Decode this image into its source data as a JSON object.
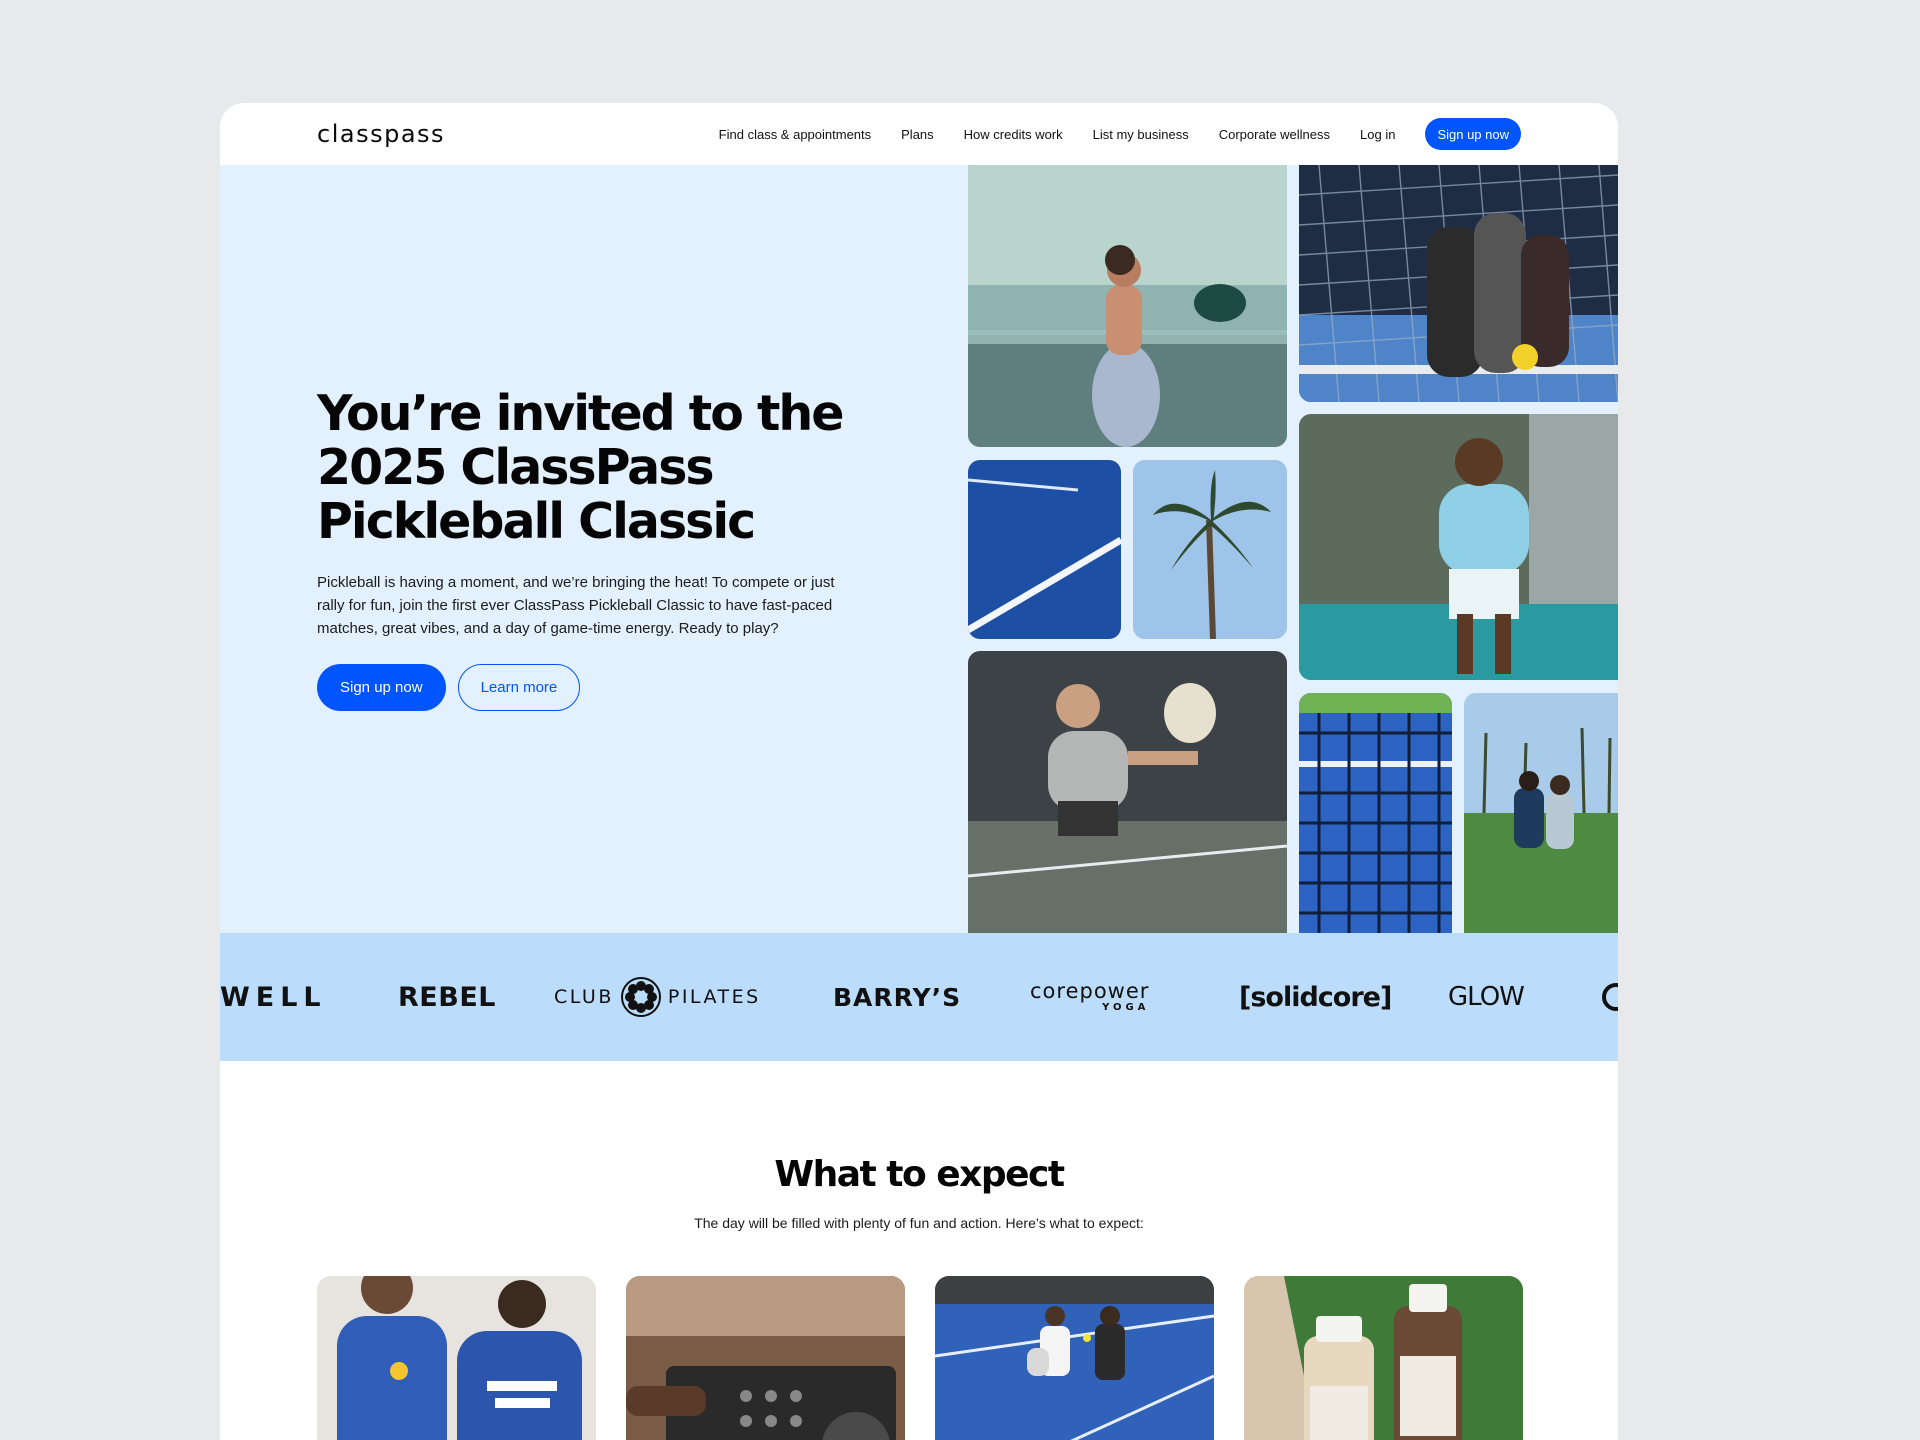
{
  "header": {
    "logo": "classpass",
    "nav": [
      {
        "label": "Find class & appointments"
      },
      {
        "label": "Plans"
      },
      {
        "label": "How credits work"
      },
      {
        "label": "List my business"
      },
      {
        "label": "Corporate wellness"
      },
      {
        "label": "Log in"
      }
    ],
    "cta_label": "Sign up now"
  },
  "hero": {
    "title_line1": "You’re invited to the",
    "title_line2": "2025 ClassPass",
    "title_line3": "Pickleball Classic",
    "description": "Pickleball is having a moment, and we’re bringing the heat! To compete or just rally for fun, join the first ever ClassPass Pickleball Classic to have fast-paced matches, great vibes, and a day of game-time energy. Ready to play?",
    "primary_button": "Sign up now",
    "secondary_button": "Learn more"
  },
  "brands": [
    {
      "name": "WELL"
    },
    {
      "name": "REBEL"
    },
    {
      "name_left": "CLUB",
      "name_right": "PILATES"
    },
    {
      "name": "BARRY’S"
    },
    {
      "name_top": "corepower",
      "name_bottom": "YOGA"
    },
    {
      "name": "[solidcore]"
    },
    {
      "name": "GLOW"
    }
  ],
  "expect": {
    "title": "What to expect",
    "subtitle": "The day will be filled with plenty of fun and action. Here’s what to expect:"
  },
  "colors": {
    "accent": "#0055ff",
    "hero_bg": "#e3f0fd",
    "brand_strip_bg": "#bcdcfb"
  }
}
